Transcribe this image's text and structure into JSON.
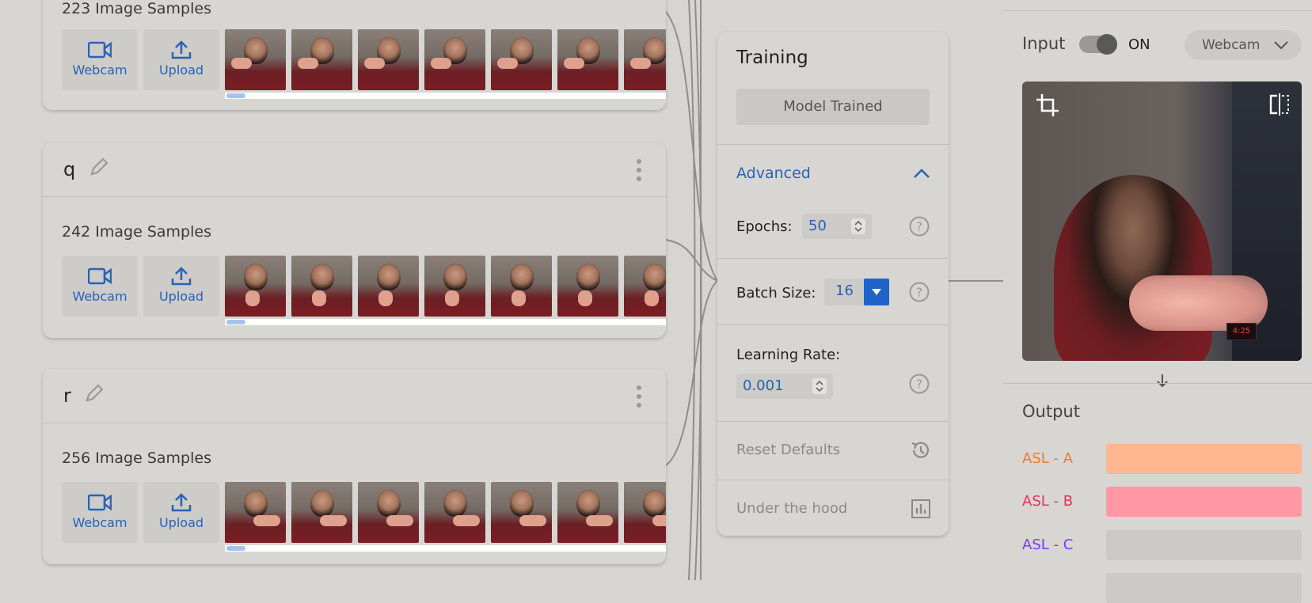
{
  "classes": [
    {
      "name": "",
      "samples_label": "223 Image Samples",
      "webcam_label": "Webcam",
      "upload_label": "Upload"
    },
    {
      "name": "q",
      "samples_label": "242 Image Samples",
      "webcam_label": "Webcam",
      "upload_label": "Upload"
    },
    {
      "name": "r",
      "samples_label": "256 Image Samples",
      "webcam_label": "Webcam",
      "upload_label": "Upload"
    }
  ],
  "training": {
    "title": "Training",
    "model_button": "Model Trained",
    "advanced_label": "Advanced",
    "epochs_label": "Epochs:",
    "epochs_value": "50",
    "batch_label": "Batch Size:",
    "batch_value": "16",
    "lr_label": "Learning Rate:",
    "lr_value": "0.001",
    "reset_label": "Reset Defaults",
    "under_hood_label": "Under the hood"
  },
  "preview": {
    "input_label": "Input",
    "toggle_state": "ON",
    "source_label": "Webcam",
    "clock_text": "4:25",
    "output_label": "Output",
    "outputs": [
      {
        "label": "ASL - A",
        "color": "#f07a2a",
        "bar_color": "#ffb691",
        "confidence": 1.0
      },
      {
        "label": "ASL - B",
        "color": "#e0355a",
        "bar_color": "#ff97a5",
        "confidence": 1.0
      },
      {
        "label": "ASL - C",
        "color": "#7b3ce8",
        "bar_color": "#cbcac7",
        "confidence": 0.0
      }
    ]
  },
  "colors": {
    "accent": "#2a62b5",
    "button_blue": "#1f62c9"
  }
}
